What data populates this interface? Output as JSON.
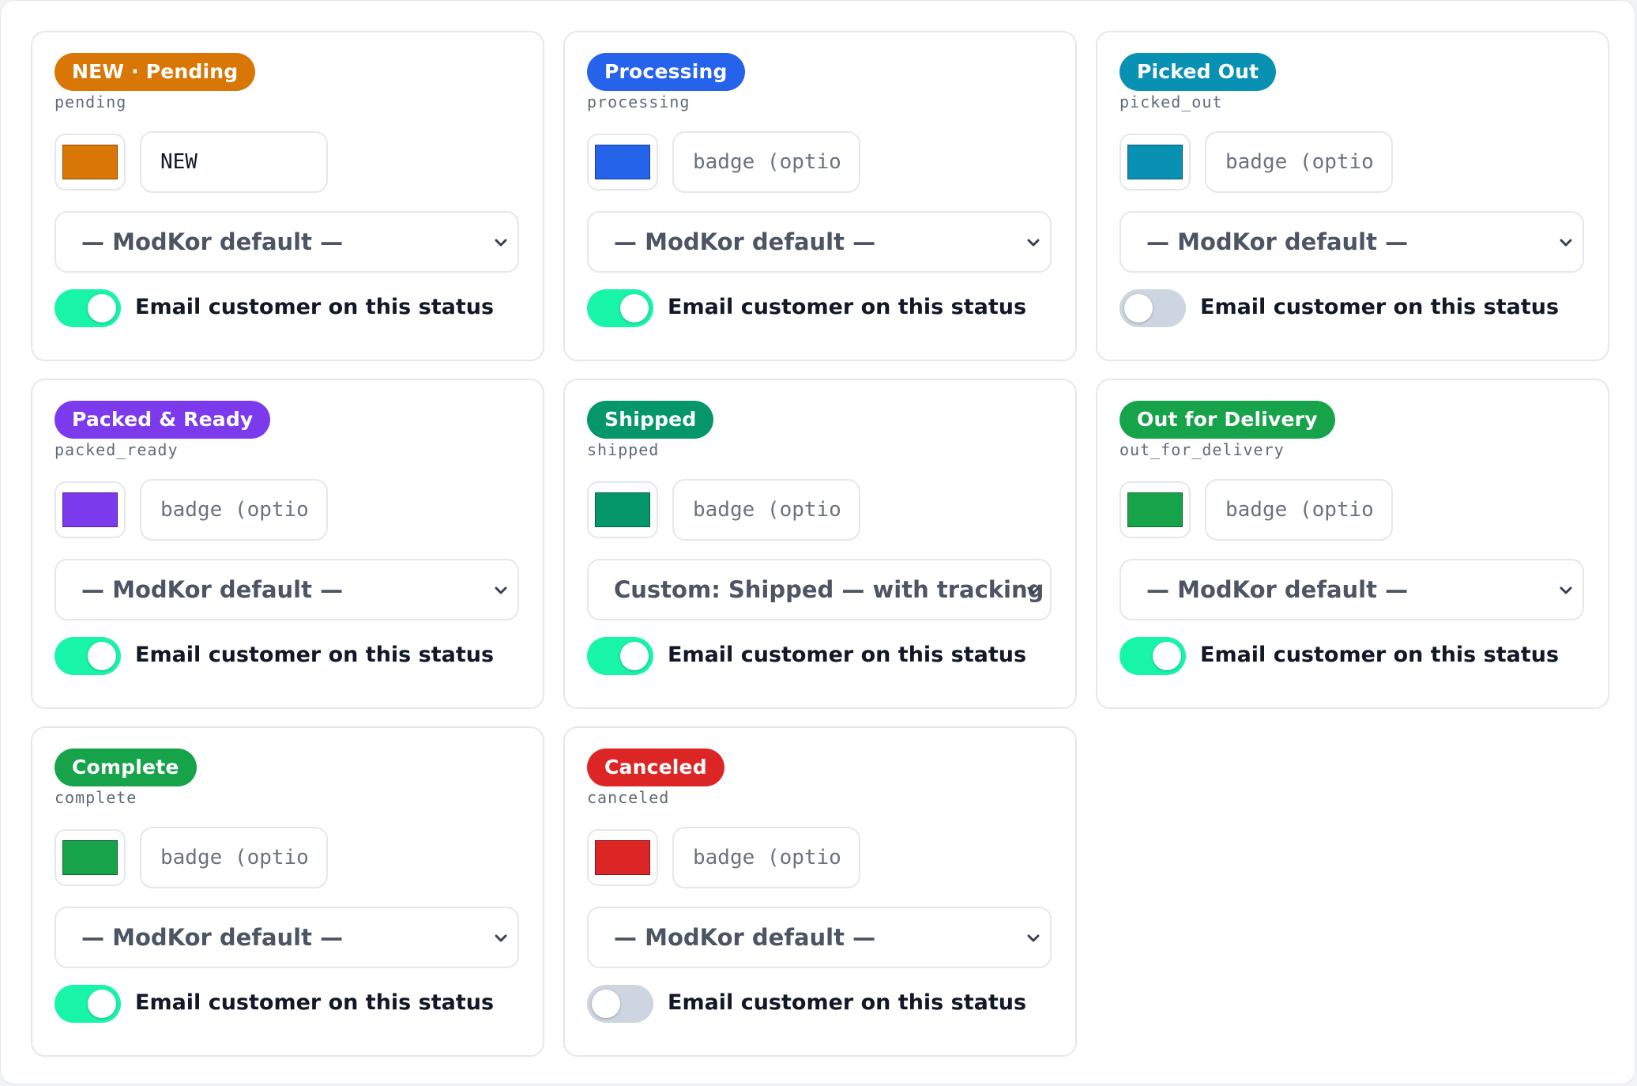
{
  "email_label": "Email customer on this status",
  "statuses": [
    {
      "badge": "NEW · Pending",
      "code": "pending",
      "color": "#d97706",
      "badge_value": "NEW",
      "badge_placeholder": "badge (optional)",
      "template": "— ModKor default —",
      "email_on": true
    },
    {
      "badge": "Processing",
      "code": "processing",
      "color": "#2563eb",
      "badge_value": "",
      "badge_placeholder": "badge (optional)",
      "template": "— ModKor default —",
      "email_on": true
    },
    {
      "badge": "Picked Out",
      "code": "picked_out",
      "color": "#0891b2",
      "badge_value": "",
      "badge_placeholder": "badge (optional)",
      "template": "— ModKor default —",
      "email_on": false
    },
    {
      "badge": "Packed & Ready",
      "code": "packed_ready",
      "color": "#7c3aed",
      "badge_value": "",
      "badge_placeholder": "badge (optional)",
      "template": "— ModKor default —",
      "email_on": true
    },
    {
      "badge": "Shipped",
      "code": "shipped",
      "color": "#059669",
      "badge_value": "",
      "badge_placeholder": "badge (optional)",
      "template": "Custom: Shipped — with tracking",
      "email_on": true
    },
    {
      "badge": "Out for Delivery",
      "code": "out_for_delivery",
      "color": "#16a34a",
      "badge_value": "",
      "badge_placeholder": "badge (optional)",
      "template": "— ModKor default —",
      "email_on": true
    },
    {
      "badge": "Complete",
      "code": "complete",
      "color": "#16a34a",
      "badge_value": "",
      "badge_placeholder": "badge (optional)",
      "template": "— ModKor default —",
      "email_on": true
    },
    {
      "badge": "Canceled",
      "code": "canceled",
      "color": "#dc2626",
      "badge_value": "",
      "badge_placeholder": "badge (optional)",
      "template": "— ModKor default —",
      "email_on": false
    }
  ]
}
